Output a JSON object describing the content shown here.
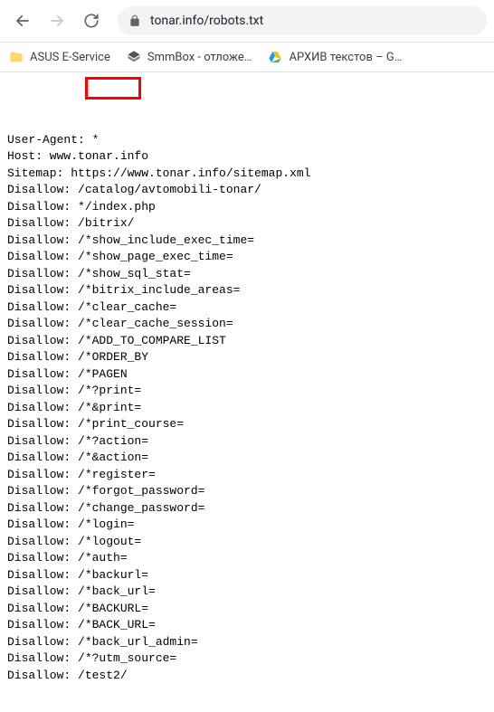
{
  "toolbar": {
    "url_host": "tonar.info",
    "url_path": "/robots.txt"
  },
  "bookmarks": [
    {
      "label": "ASUS E-Service",
      "icon": "folder"
    },
    {
      "label": "SmmBox - отложе…",
      "icon": "smmbox"
    },
    {
      "label": "АРХИВ текстов – G…",
      "icon": "gdrive"
    }
  ],
  "robots": [
    "User-Agent: *",
    "Host: www.tonar.info",
    "Sitemap: https://www.tonar.info/sitemap.xml",
    "Disallow: /catalog/avtomobili-tonar/",
    "Disallow: */index.php",
    "Disallow: /bitrix/",
    "Disallow: /*show_include_exec_time=",
    "Disallow: /*show_page_exec_time=",
    "Disallow: /*show_sql_stat=",
    "Disallow: /*bitrix_include_areas=",
    "Disallow: /*clear_cache=",
    "Disallow: /*clear_cache_session=",
    "Disallow: /*ADD_TO_COMPARE_LIST",
    "Disallow: /*ORDER_BY",
    "Disallow: /*PAGEN",
    "Disallow: /*?print=",
    "Disallow: /*&print=",
    "Disallow: /*print_course=",
    "Disallow: /*?action=",
    "Disallow: /*&action=",
    "Disallow: /*register=",
    "Disallow: /*forgot_password=",
    "Disallow: /*change_password=",
    "Disallow: /*login=",
    "Disallow: /*logout=",
    "Disallow: /*auth=",
    "Disallow: /*backurl=",
    "Disallow: /*back_url=",
    "Disallow: /*BACKURL=",
    "Disallow: /*BACK_URL=",
    "Disallow: /*back_url_admin=",
    "Disallow: /*?utm_source=",
    "Disallow: /test2/"
  ]
}
